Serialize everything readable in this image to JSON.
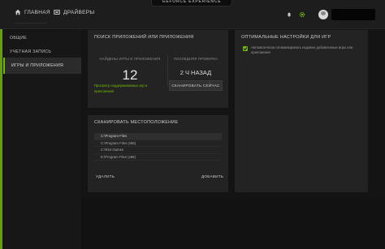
{
  "header": {
    "nav_home": "ГЛАВНАЯ",
    "nav_drivers": "ДРАЙВЕРЫ",
    "brand": "GEFORCE EXPERIENCE",
    "accent_color": "#76b900"
  },
  "icons": {
    "home": "home-icon",
    "drivers": "drivers-icon",
    "notifications": "bell-icon",
    "settings": "gear-icon",
    "avatar": "user-avatar"
  },
  "sidebar": {
    "items": [
      {
        "label": "ОБЩИЕ"
      },
      {
        "label": "УЧЕТНАЯ ЗАПИСЬ"
      },
      {
        "label": "ИГРЫ И ПРИЛОЖЕНИЯ"
      }
    ]
  },
  "scan_section": {
    "title": "ПОИСК ПРИЛОЖЕНИЙ ИЛИ ПРИЛОЖЕНИЯ",
    "found_label": "НАЙДЕНЫ ИГРЫ И ПРИЛОЖЕНИЯ",
    "found_count": "12",
    "last_scan_label": "ПОСЛЕДНЯЯ ПРОВЕРКА",
    "last_scan_value": "2 Ч НАЗАД",
    "supported_link": "Просмотр поддерживаемых игр и приложений",
    "scan_button": "СКАНИРОВАТЬ СЕЙЧАС"
  },
  "optimal_section": {
    "title": "ОПТИМАЛЬНЫЕ НАСТРОЙКИ ДЛЯ ИГР",
    "checkbox_checked": true,
    "checkbox_text": "Автоматически оптимизировать недавно добавленные игры или приложения"
  },
  "location_section": {
    "title": "СКАНИРОВАТЬ МЕСТОПОЛОЖЕНИЕ",
    "paths": [
      "C:\\Program Files",
      "C:\\Program Files (x86)",
      "C:\\Riot Games",
      "E:\\Program Files (x86)"
    ],
    "remove_label": "УДАЛИТЬ",
    "add_label": "ДОБАВИТЬ"
  }
}
